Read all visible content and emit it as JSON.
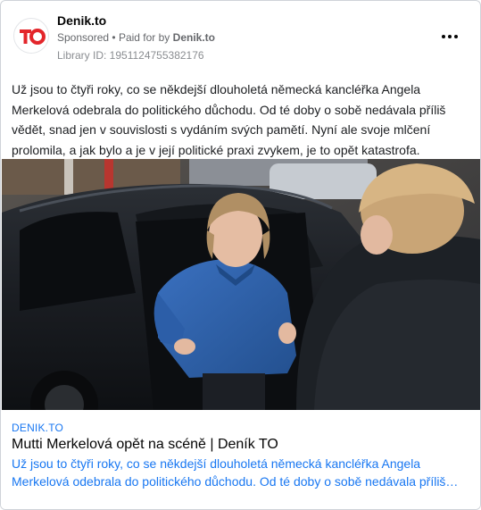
{
  "post": {
    "page_name": "Denik.to",
    "sponsored_label": "Sponsored",
    "paid_for_prefix": "Paid for by",
    "paid_for_name": "Denik.to",
    "separator": "•",
    "library_id": "Library ID: 1951124755382176",
    "avatar_logo_text": "TO",
    "more_icon": "more-horizontal-icon",
    "body_text": "Už jsou to čtyři roky, co se někdejší dlouholetá německá kancléřka Angela Merkelová odebrala do politického důchodu. Od té doby o sobě nedávala příliš vědět, snad jen v souvislosti s vydáním svých pamětí. Nyní ale svoje mlčení prolomila, a jak bylo a je v její politické praxi zvykem, je to opět katastrofa."
  },
  "link_preview": {
    "domain": "DENIK.TO",
    "title": "Mutti Merkelová opět na scéně | Deník TO",
    "description": "Už jsou to čtyři roky, co se někdejší dlouholetá německá kancléřka Angela Merkelová odebrala do politického důchodu. Od té doby o sobě nedávala příliš…"
  },
  "colors": {
    "brand_red": "#e3262b",
    "link_blue": "#1877f2",
    "coat_blue": "#2f5fa8"
  }
}
